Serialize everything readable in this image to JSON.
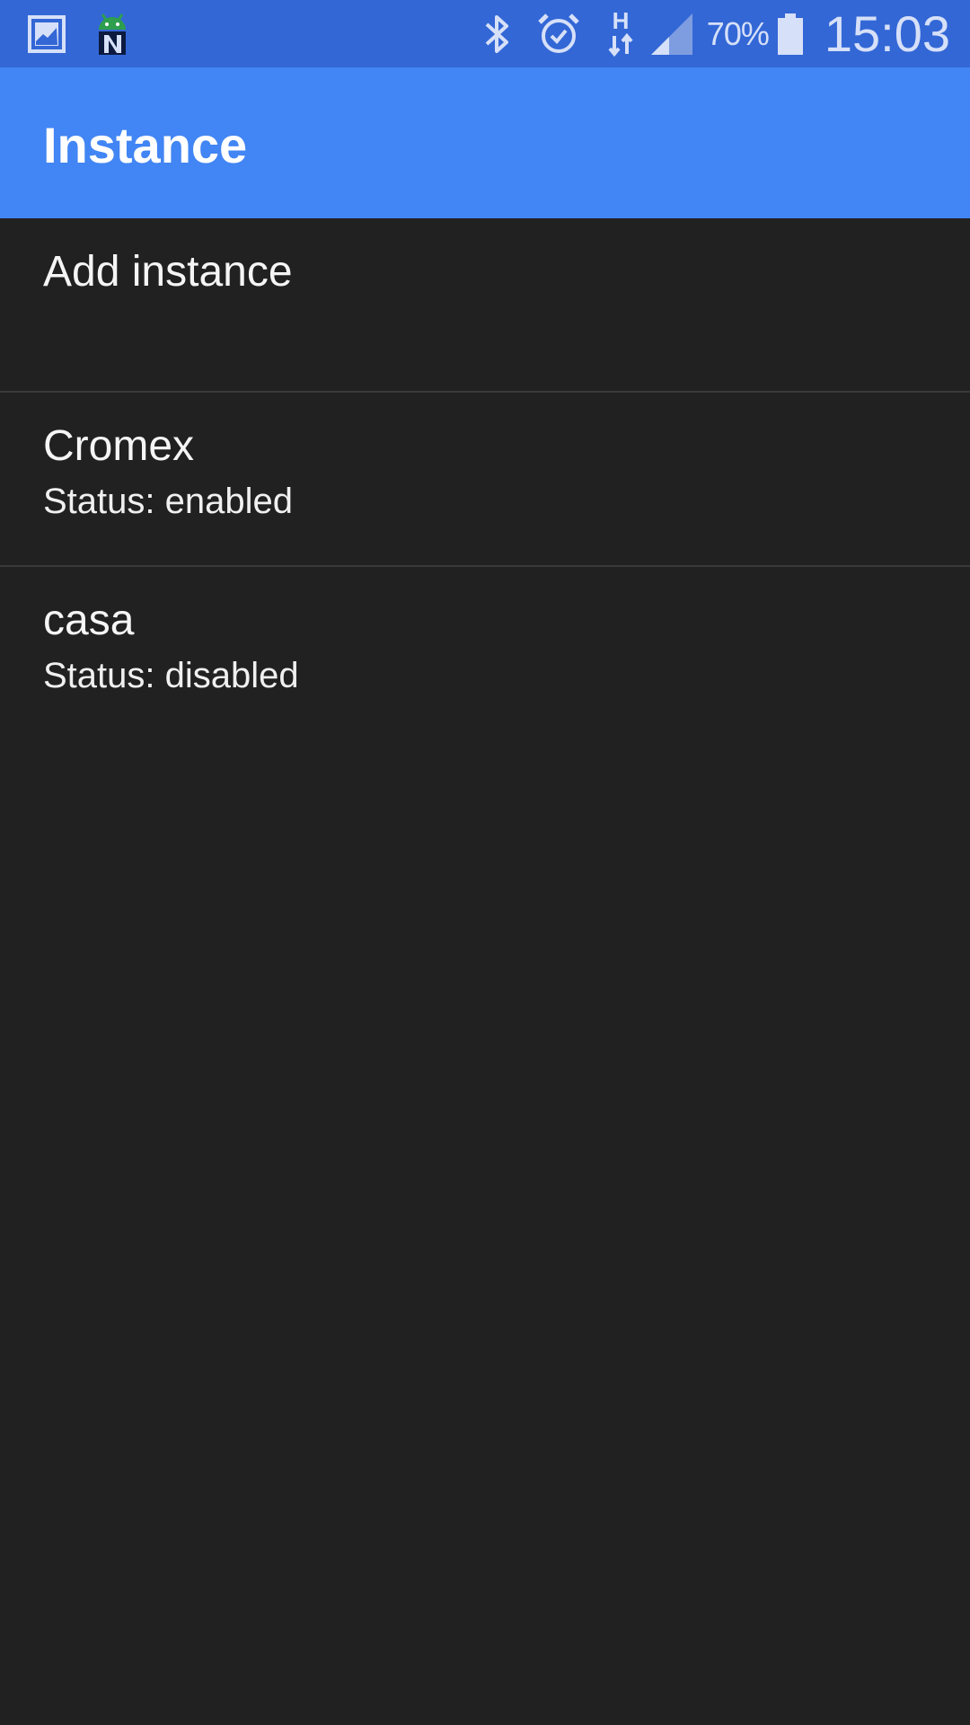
{
  "status_bar": {
    "notification_icons": [
      "gallery-icon",
      "android-n-icon"
    ],
    "system_icons": [
      "bluetooth-icon",
      "alarm-icon",
      "network-h-icon",
      "signal-icon",
      "battery-icon"
    ],
    "network_type": "H",
    "battery_percent": "70%",
    "battery_level": 0.7,
    "time": "15:03",
    "colors": {
      "background": "#3367d6",
      "text": "#d6e0f8"
    }
  },
  "app_bar": {
    "title": "Instance",
    "color": "#4285f4"
  },
  "list": {
    "add_item": {
      "label": "Add instance"
    },
    "instances": [
      {
        "name": "Cromex",
        "status": "Status: enabled"
      },
      {
        "name": "casa",
        "status": "Status: disabled"
      }
    ]
  },
  "colors": {
    "background": "#212121",
    "divider": "#3a3a3a"
  }
}
